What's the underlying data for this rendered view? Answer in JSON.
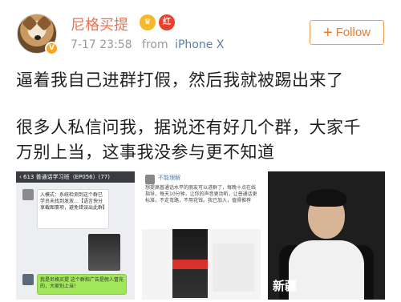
{
  "post": {
    "username": "尼格买提",
    "badge_vip_icon": "vip-crown-icon",
    "badge_hot_label": "红",
    "verified_label": "V",
    "time": "7-17 23:58",
    "from_label": "from",
    "device": "iPhone X",
    "follow_label": "Follow",
    "follow_plus": "+",
    "text_lines": [
      "逼着我自己进群打假，然后我就被踢出来了",
      "很多人私信问我，据说还有好几个群，大家千",
      "万别上当，这事我没参与更不知道"
    ]
  },
  "images": {
    "img1_header": "‹ 613   普通话学习班（EP056）(77)",
    "img1_bubble1": "入模式：系统检测到这个群已学员未找到发放…【语言快分享截图事项，避免错误出此群】",
    "img1_bubble2": "我是尼格买提 这个群和广告是假人冒充的，大家别上当！",
    "img2_name": "不能理解",
    "img2_text": "想提高普通话水平的朋友可以进群了，每晚十点在线指导，每天10分钟，让你的声音更动听，让普通话更标准，不走弯路，不用花钱。我已加入，值得推荐",
    "img3_caption": "新疆"
  },
  "colors": {
    "username": "#eb7350",
    "follow": "#e47b32",
    "device_link": "#5d7fa8"
  }
}
